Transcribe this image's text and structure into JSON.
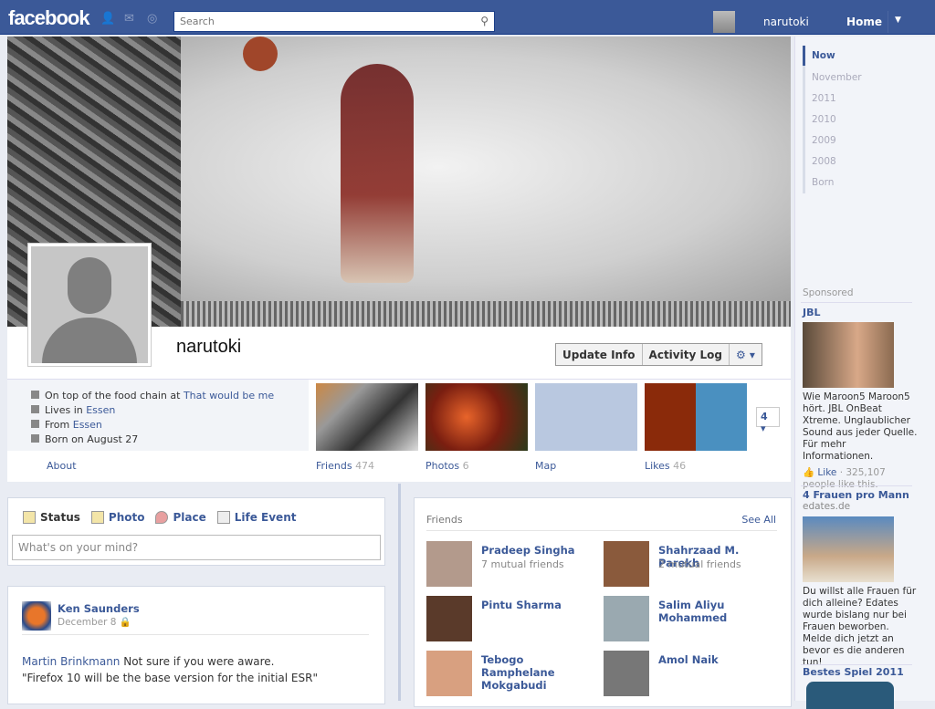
{
  "topbar": {
    "logo": "facebook",
    "search_placeholder": "Search",
    "username": "narutoki",
    "home": "Home"
  },
  "profile": {
    "name": "narutoki",
    "buttons": [
      "Update Info",
      "Activity Log",
      "⚙ ▾"
    ]
  },
  "about": {
    "lines": [
      {
        "text": "On top of the food chain at ",
        "link": "That would be me"
      },
      {
        "text": "Lives in ",
        "link": "Essen"
      },
      {
        "text": "From ",
        "link": "Essen"
      },
      {
        "text": "Born on August 27",
        "link": ""
      }
    ],
    "label": "About"
  },
  "tiles": [
    {
      "label": "Friends",
      "count": "474"
    },
    {
      "label": "Photos",
      "count": "6"
    },
    {
      "label": "Map",
      "count": ""
    },
    {
      "label": "Likes",
      "count": "46"
    }
  ],
  "more_count": "4 ▾",
  "composer": {
    "tabs": [
      "Status",
      "Photo",
      "Place",
      "Life Event"
    ],
    "placeholder": "What's on your mind?"
  },
  "post": {
    "author": "Ken Saunders",
    "date": "December 8",
    "mention": "Martin Brinkmann",
    "text1": " Not sure if you were aware.",
    "text2": "\"Firefox 10 will be the base version for the initial ESR\""
  },
  "friends": {
    "title": "Friends",
    "see_all": "See All",
    "items": [
      {
        "name": "Pradeep Singha",
        "mutual": "7 mutual friends",
        "color": "#b39a8c"
      },
      {
        "name": "Shahrzaad M. Parekh",
        "mutual": "2 mutual friends",
        "color": "#8a5a3c"
      },
      {
        "name": "Pintu Sharma",
        "mutual": "",
        "color": "#5a3a2a"
      },
      {
        "name": "Salim Aliyu Mohammed",
        "mutual": "",
        "color": "#9aa9b0"
      },
      {
        "name": "Tebogo Ramphelane Mokgabudi",
        "mutual": "",
        "color": "#d8a080"
      },
      {
        "name": "Amol Naik",
        "mutual": "",
        "color": "#777"
      }
    ]
  },
  "timeline": [
    "Now",
    "November",
    "2011",
    "2010",
    "2009",
    "2008",
    "Born"
  ],
  "sponsored": {
    "label": "Sponsored",
    "ads": [
      {
        "title": "JBL",
        "source": "",
        "text": "Wie Maroon5 Maroon5 hört. JBL OnBeat Xtreme. Unglaublicher Sound aus jeder Quelle. Für mehr Informationen.",
        "like": "Like",
        "likes": "325,107 people like this."
      },
      {
        "title": "4 Frauen pro Mann",
        "source": "edates.de",
        "text": "Du willst alle Frauen für dich alleine? Edates wurde bislang nur bei Frauen beworben. Melde dich jetzt an bevor es die anderen tun!"
      },
      {
        "title": "Bestes Spiel 2011"
      }
    ]
  }
}
